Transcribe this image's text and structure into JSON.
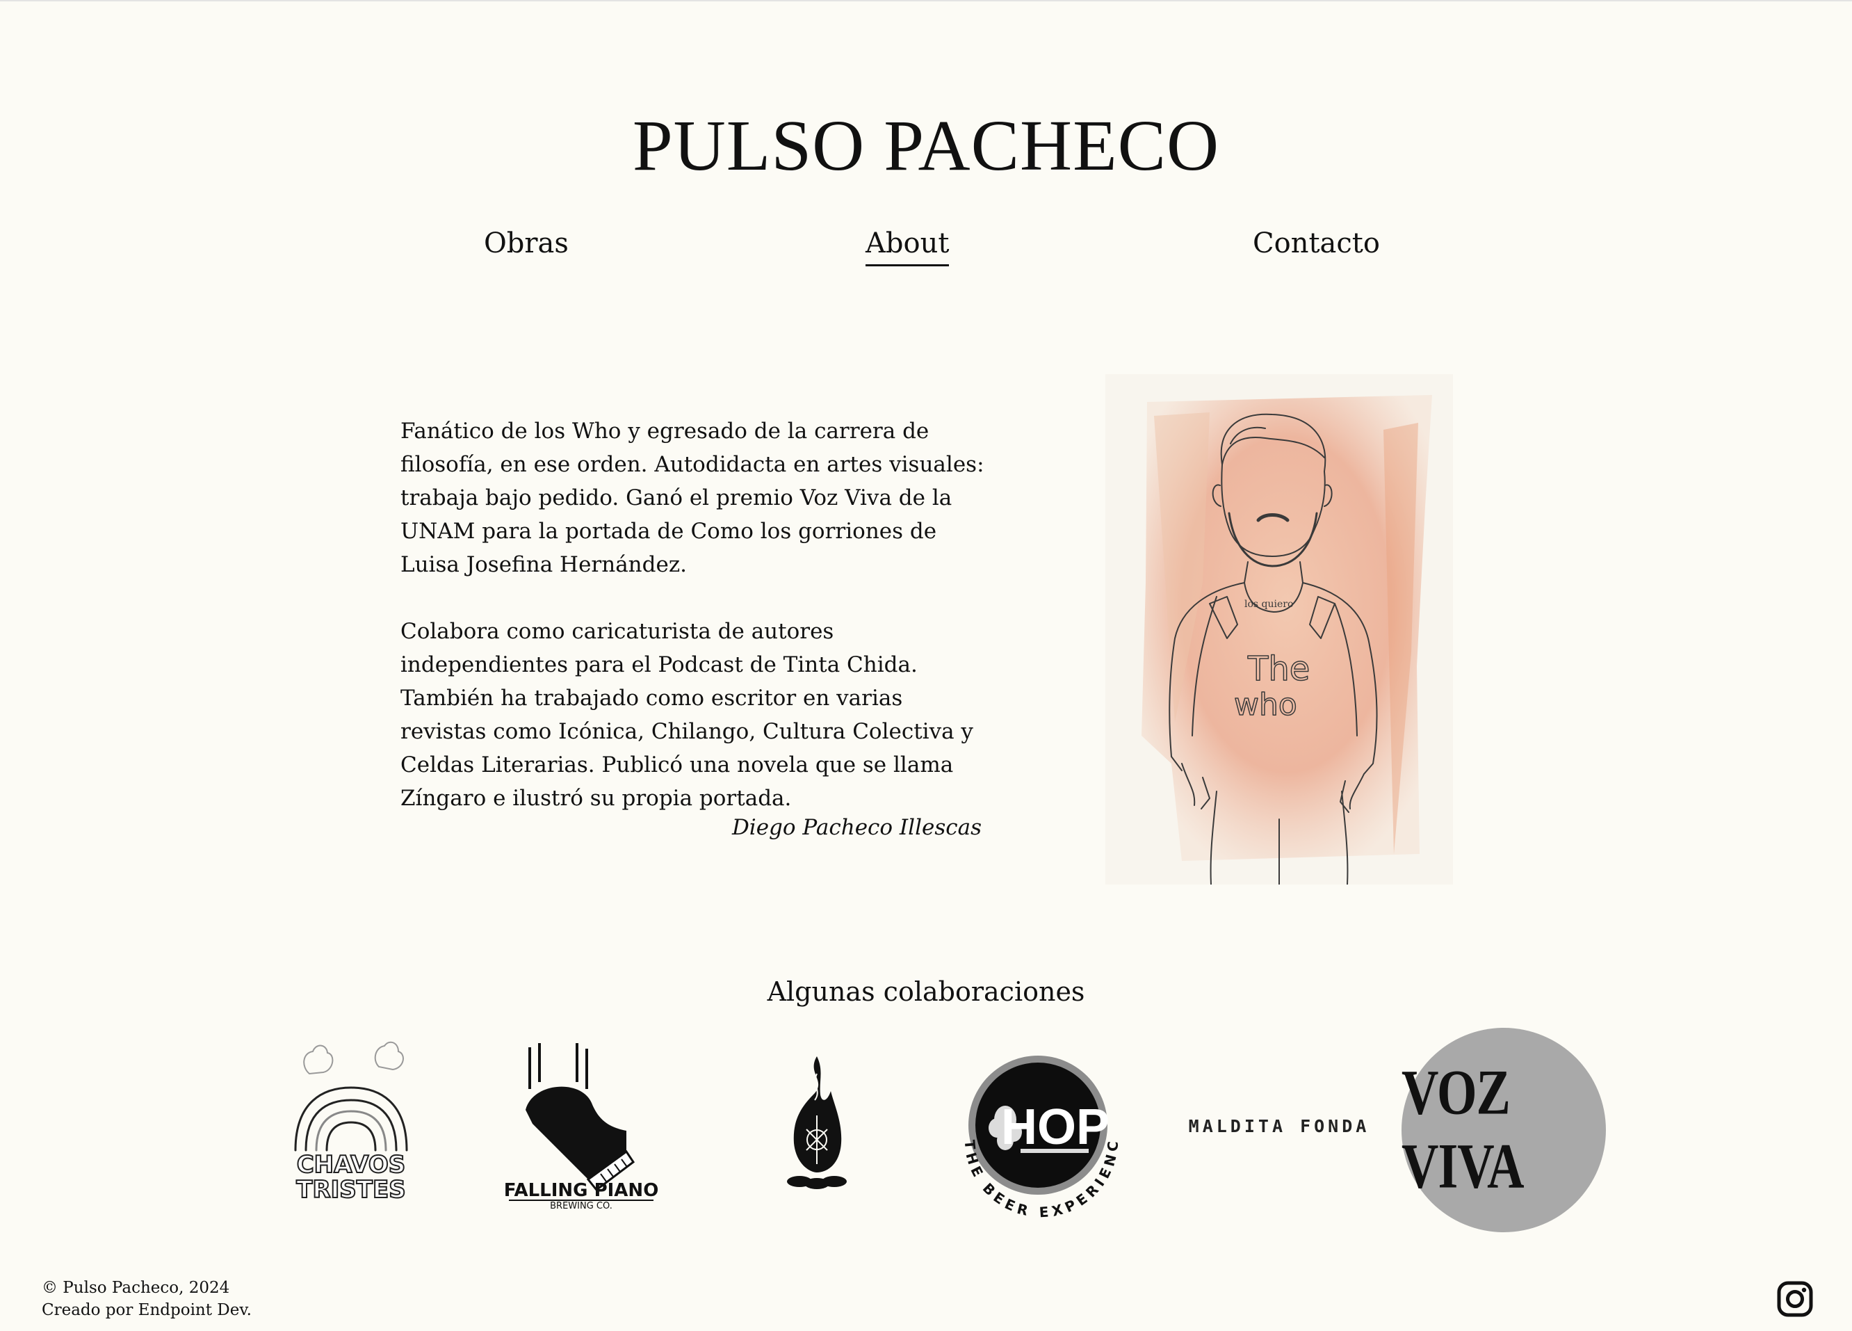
{
  "site": {
    "title": "PULSO PACHECO"
  },
  "nav": {
    "items": [
      {
        "label": "Obras"
      },
      {
        "label": "About",
        "active": true
      },
      {
        "label": "Contacto"
      }
    ]
  },
  "about": {
    "paragraphs": [
      "Fanático de los Who y egresado de la carrera de filosofía, en ese orden. Autodidacta en artes visuales: trabaja bajo pedido. Ganó el premio Voz Viva de la UNAM para la portada de Como los gorriones de Luisa Josefina Hernández.",
      "Colabora como caricaturista de autores independientes para el Podcast de Tinta Chida. También ha trabajado como escritor en varias revistas como Icónica, Chilango, Cultura Colectiva y Celdas Literarias. Publicó una novela que se llama Zíngaro e ilustró su propia portada."
    ],
    "signature": "Diego Pacheco Illescas",
    "portrait": {
      "icon": "portrait-illustration",
      "shirt_text": [
        "The",
        "who"
      ],
      "collar_text": "los quiero"
    }
  },
  "collaborations": {
    "title": "Algunas colaboraciones",
    "logos": {
      "chavos": {
        "line1": "CHAVOS",
        "line2": "TRISTES"
      },
      "piano": {
        "line1": "FALLING PIANO",
        "line2": "BREWING CO."
      },
      "fire": {
        "icon": "campfire-icon"
      },
      "hop": {
        "center": "HOP",
        "ring": "THE BEER EXPERIENCE"
      },
      "maldita": {
        "text": "MALDITA FONDA"
      },
      "vozviva": {
        "text": "VOZ VIVA"
      }
    }
  },
  "footer": {
    "copyright": "© Pulso Pacheco, 2024",
    "credit": "Creado por Endpoint Dev."
  },
  "social": {
    "icon": "instagram-icon"
  },
  "colors": {
    "background": "#fcfbf5",
    "text": "#111111",
    "vozviva_circle": "#a9a9a9",
    "portrait_wash": "#e9a184"
  }
}
